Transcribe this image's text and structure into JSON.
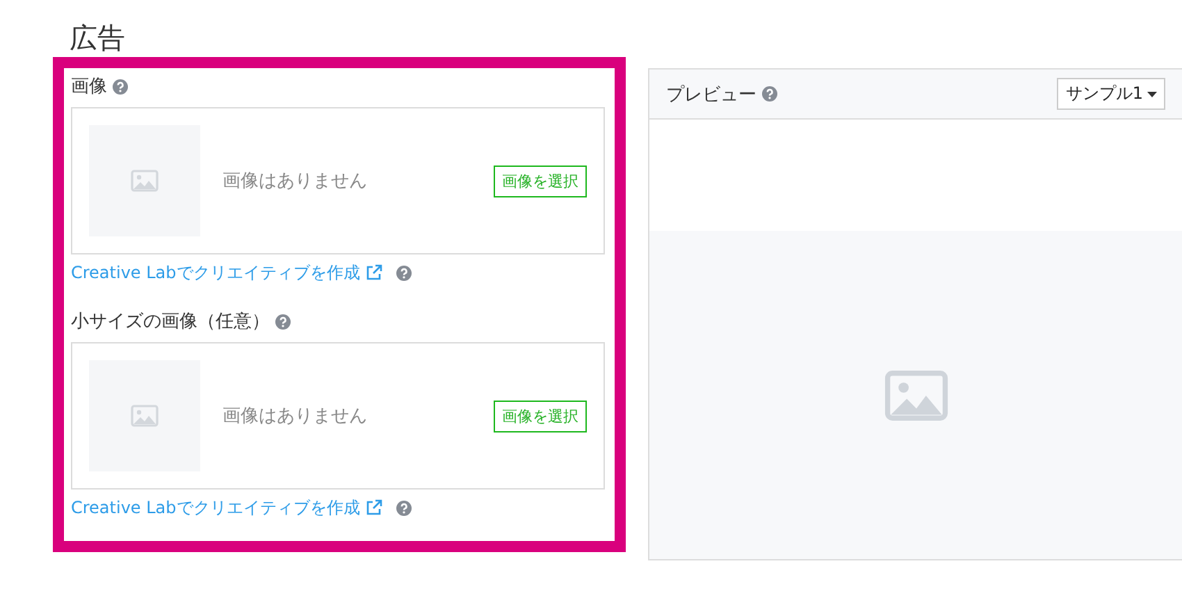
{
  "page_title": "広告",
  "image_fields": [
    {
      "label": "画像",
      "empty_text": "画像はありません",
      "button": "画像を選択",
      "link": "Creative Labでクリエイティブを作成"
    },
    {
      "label": "小サイズの画像（任意）",
      "empty_text": "画像はありません",
      "button": "画像を選択",
      "link": "Creative Labでクリエイティブを作成"
    }
  ],
  "preview": {
    "title": "プレビュー",
    "dropdown": "サンプル1"
  }
}
